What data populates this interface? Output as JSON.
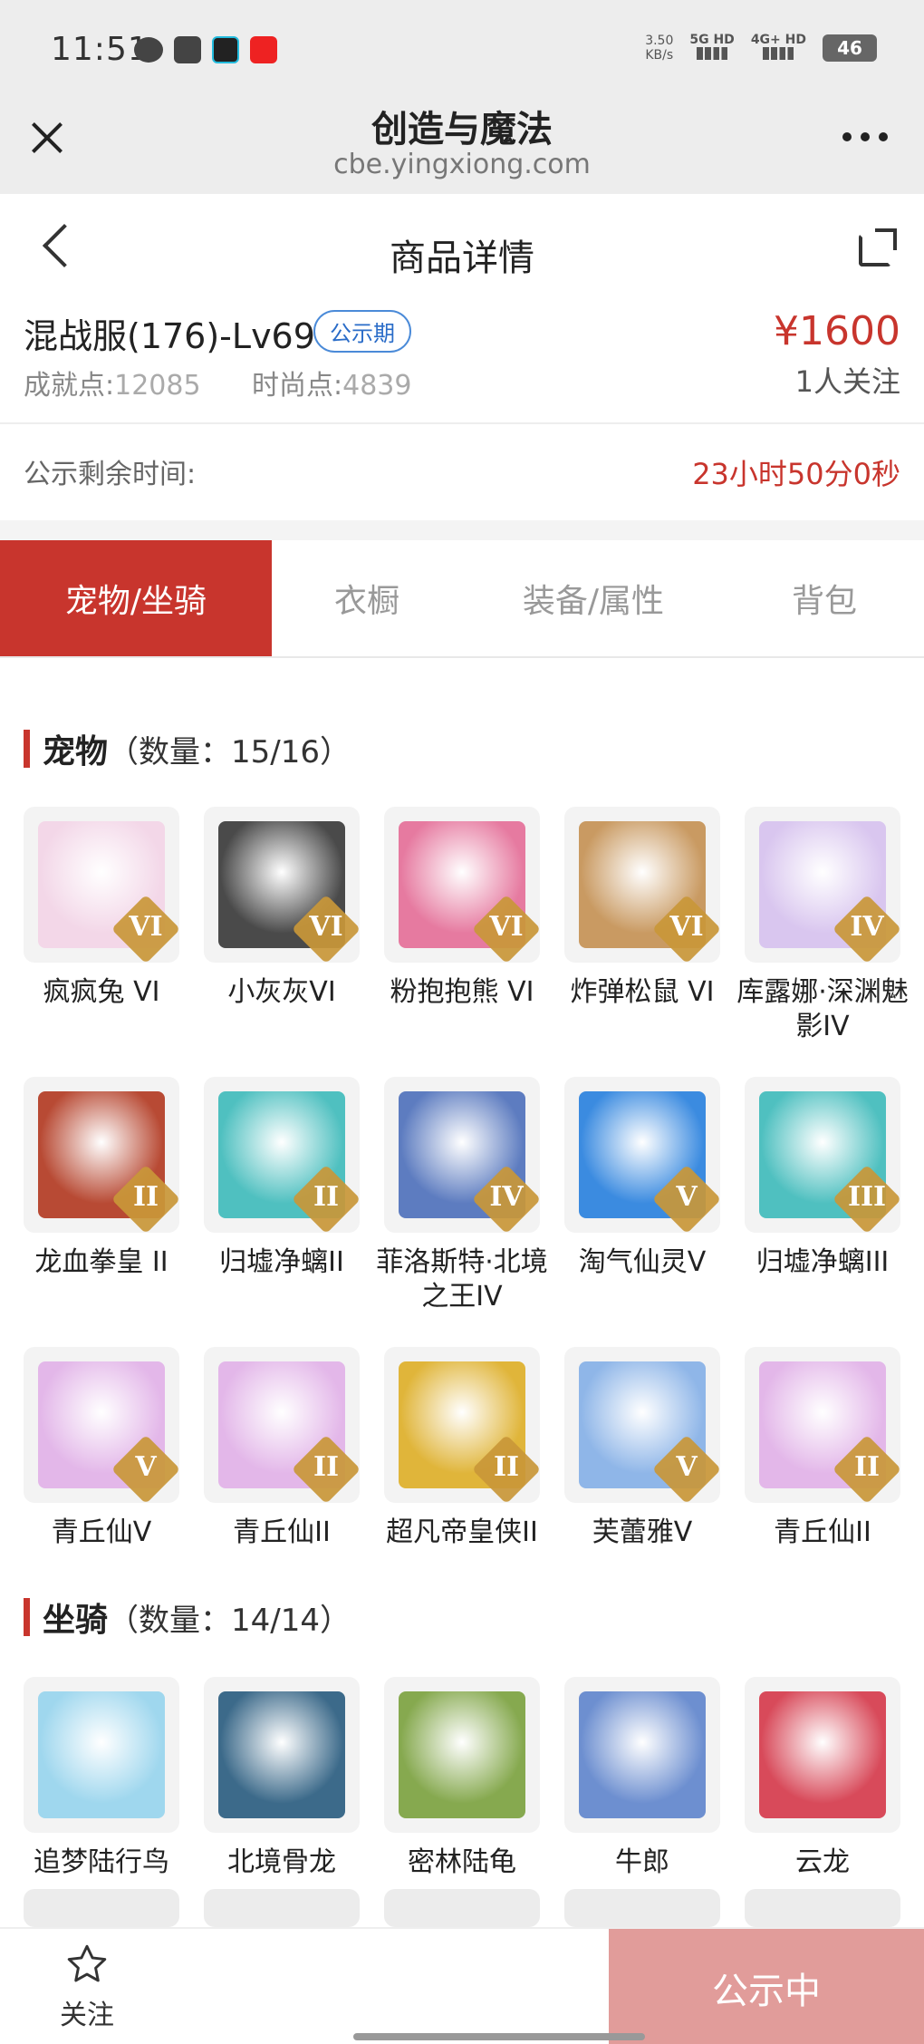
{
  "status": {
    "time": "11:51",
    "speed_top": "3.50",
    "speed_unit": "KB/s",
    "net1": "5G HD",
    "net2": "4G+ HD",
    "battery": "46"
  },
  "browser": {
    "title": "创造与魔法",
    "url": "cbe.yingxiong.com"
  },
  "header": {
    "title": "商品详情"
  },
  "product": {
    "name": "混战服(176)-Lv69",
    "badge": "公示期",
    "achievement_label": "成就点:",
    "achievement_value": "12085",
    "fashion_label": "时尚点:",
    "fashion_value": "4839",
    "price": "¥1600",
    "followers": "1人关注"
  },
  "remain": {
    "label": "公示剩余时间:",
    "value": "23小时50分0秒"
  },
  "tabs": [
    {
      "label": "宠物/坐骑",
      "active": true
    },
    {
      "label": "衣橱",
      "active": false
    },
    {
      "label": "装备/属性",
      "active": false
    },
    {
      "label": "背包",
      "active": false
    }
  ],
  "pets": {
    "title": "宠物",
    "count": "（数量：15/16）",
    "items": [
      {
        "name": "疯疯兔 VI",
        "tier": "VI",
        "color": "#f3d7e8"
      },
      {
        "name": "小灰灰VI",
        "tier": "VI",
        "color": "#4a4a4a"
      },
      {
        "name": "粉抱抱熊 VI",
        "tier": "VI",
        "color": "#e67aa0"
      },
      {
        "name": "炸弹松鼠 VI",
        "tier": "VI",
        "color": "#c99a62"
      },
      {
        "name": "库露娜·深渊魅影IV",
        "tier": "IV",
        "color": "#d9c6ef"
      },
      {
        "name": "龙血拳皇 II",
        "tier": "II",
        "color": "#b84a34"
      },
      {
        "name": "归墟净螭II",
        "tier": "II",
        "color": "#4fc0c0"
      },
      {
        "name": "菲洛斯特·北境之王IV",
        "tier": "IV",
        "color": "#5d7cc0"
      },
      {
        "name": "淘气仙灵V",
        "tier": "V",
        "color": "#3b8be0"
      },
      {
        "name": "归墟净螭III",
        "tier": "III",
        "color": "#4fc0c0"
      },
      {
        "name": "青丘仙V",
        "tier": "V",
        "color": "#e3b7e9"
      },
      {
        "name": "青丘仙II",
        "tier": "II",
        "color": "#e3b7e9"
      },
      {
        "name": "超凡帝皇侠II",
        "tier": "II",
        "color": "#e0b53a"
      },
      {
        "name": "芙蕾雅V",
        "tier": "V",
        "color": "#8fb6e8"
      },
      {
        "name": "青丘仙II",
        "tier": "II",
        "color": "#e3b7e9"
      }
    ]
  },
  "mounts": {
    "title": "坐骑",
    "count": "（数量：14/14）",
    "items": [
      {
        "name": "追梦陆行鸟",
        "color": "#9fd7ee"
      },
      {
        "name": "北境骨龙",
        "color": "#3c6a8a"
      },
      {
        "name": "密林陆龟",
        "color": "#86a94f"
      },
      {
        "name": "牛郎",
        "color": "#6d8fd0"
      },
      {
        "name": "云龙",
        "color": "#d84a5a"
      }
    ]
  },
  "bottom": {
    "follow_label": "关注",
    "action_label": "公示中"
  }
}
